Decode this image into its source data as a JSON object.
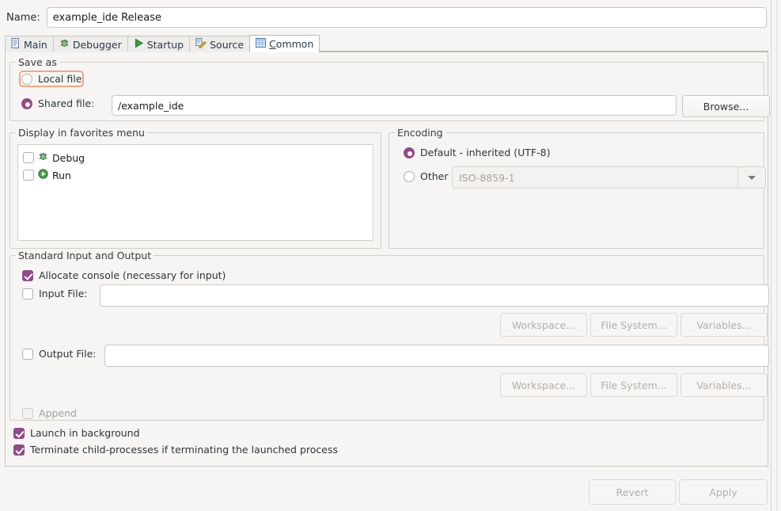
{
  "window": {
    "name_label": "Name:",
    "name_value": "example_ide Release"
  },
  "tabs": [
    {
      "label": "Main",
      "icon": "document-icon",
      "active": false
    },
    {
      "label": "Debugger",
      "icon": "bug-icon",
      "active": false
    },
    {
      "label": "Startup",
      "icon": "play-icon",
      "active": false
    },
    {
      "label": "Source",
      "icon": "source-edit-icon",
      "active": false
    },
    {
      "label": "Common",
      "icon": "common-table-icon",
      "active": true,
      "mnemonic": "C",
      "rest": "ommon"
    }
  ],
  "save_as": {
    "title": "Save as",
    "local_file_label": "Local file",
    "local_file_selected": false,
    "local_file_focused": true,
    "shared_file_label": "Shared file:",
    "shared_file_selected": true,
    "shared_file_value": "/example_ide",
    "browse_label": "Browse..."
  },
  "favorites": {
    "title": "Display in favorites menu",
    "items": [
      {
        "label": "Debug",
        "icon": "bug-icon",
        "checked": false
      },
      {
        "label": "Run",
        "icon": "run-green-play-icon",
        "checked": false
      }
    ]
  },
  "encoding": {
    "title": "Encoding",
    "default_label": "Default - inherited (UTF-8)",
    "default_selected": true,
    "other_label": "Other",
    "other_selected": false,
    "other_value": "ISO-8859-1",
    "other_disabled": true
  },
  "stdio": {
    "title": "Standard Input and Output",
    "allocate_console_label": "Allocate console (necessary for input)",
    "allocate_console_checked": true,
    "input_file_label": "Input File:",
    "input_file_checked": false,
    "input_file_value": "",
    "input_buttons": [
      {
        "label": "Workspace...",
        "disabled": true
      },
      {
        "label": "File System...",
        "disabled": true
      },
      {
        "label": "Variables...",
        "disabled": true
      }
    ],
    "output_file_label": "Output File:",
    "output_file_checked": false,
    "output_file_value": "",
    "output_buttons": [
      {
        "label": "Workspace...",
        "disabled": true
      },
      {
        "label": "File System...",
        "disabled": true
      },
      {
        "label": "Variables...",
        "disabled": true
      }
    ],
    "append_label": "Append",
    "append_checked": false,
    "append_disabled": true
  },
  "options": [
    {
      "label": "Launch in background",
      "checked": true
    },
    {
      "label": "Terminate child-processes if terminating the launched process",
      "checked": true
    }
  ],
  "footer": {
    "revert_label": "Revert",
    "revert_disabled": true,
    "apply_label": "Apply",
    "apply_disabled": true
  },
  "colors": {
    "accent": "#8f4c86",
    "focus_outline": "#f2a585",
    "background": "#f6f5f4",
    "tab_text": "#2b3a4a"
  }
}
